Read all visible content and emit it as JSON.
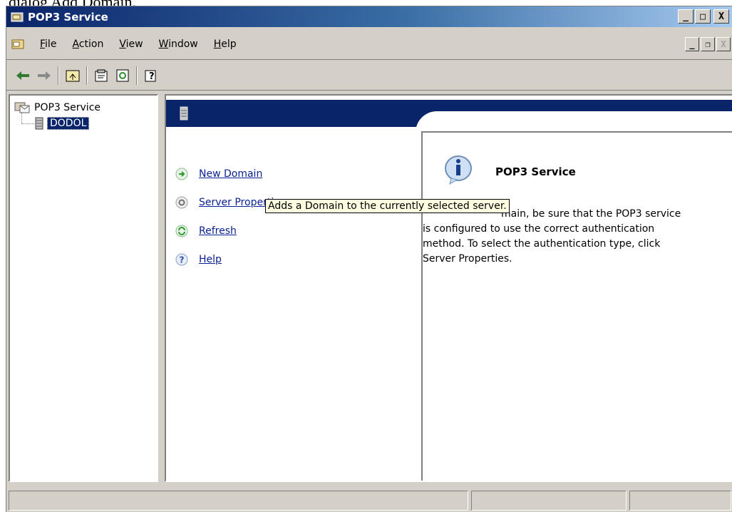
{
  "caption": "dialog Add Domain.",
  "window": {
    "title": "POP3 Service"
  },
  "title_buttons": {
    "minimize": "_",
    "maximize": "□",
    "close": "X"
  },
  "child_buttons": {
    "minimize": "_",
    "restore": "❐",
    "close": "X"
  },
  "menu": {
    "items": [
      {
        "accel": "F",
        "rest": "ile"
      },
      {
        "accel": "A",
        "rest": "ction"
      },
      {
        "accel": "V",
        "rest": "iew"
      },
      {
        "accel": "W",
        "rest": "indow"
      },
      {
        "accel": "H",
        "rest": "elp"
      }
    ]
  },
  "toolbar": {
    "icons": [
      "back-arrow-icon",
      "forward-arrow-icon",
      "up-folder-icon",
      "properties-icon",
      "refresh-icon",
      "help-icon"
    ]
  },
  "tree": {
    "root_label": "POP3 Service",
    "child_label": "DODOL"
  },
  "tasks": [
    {
      "label": "New Domain",
      "icon": "green-arrow-icon"
    },
    {
      "label": "Server Properties",
      "icon": "gear-icon"
    },
    {
      "label": "Refresh",
      "icon": "refresh-icon"
    },
    {
      "label": "Help",
      "icon": "help-icon"
    }
  ],
  "info": {
    "title": "POP3 Service",
    "text_line1": "main, be sure that the",
    "text_rest": "POP3 service is configured to use the correct authentication method. To select the authentication type, click Server Properties."
  },
  "tooltip": "Adds a Domain to the currently selected server.",
  "colors": {
    "titlebar": "#0a246a",
    "selection": "#0a246a",
    "tooltip": "#ffffe1",
    "link": "#0a1f8f"
  }
}
